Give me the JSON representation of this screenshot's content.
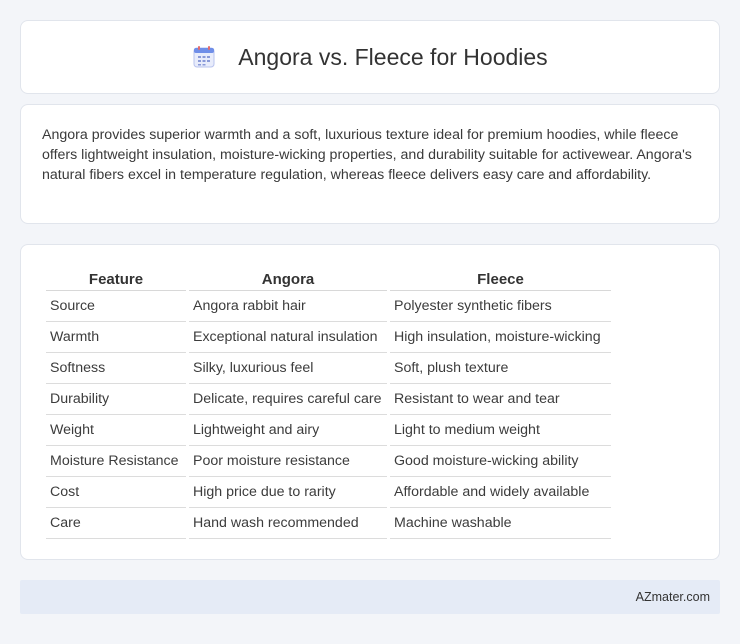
{
  "header": {
    "title": "Angora vs. Fleece for Hoodies",
    "icon": "calendar-icon"
  },
  "summary": {
    "text": "Angora provides superior warmth and a soft, luxurious texture ideal for premium hoodies, while fleece offers lightweight insulation, moisture-wicking properties, and durability suitable for activewear. Angora's natural fibers excel in temperature regulation, whereas fleece delivers easy care and affordability."
  },
  "table": {
    "headers": [
      "Feature",
      "Angora",
      "Fleece"
    ],
    "rows": [
      [
        "Source",
        "Angora rabbit hair",
        "Polyester synthetic fibers"
      ],
      [
        "Warmth",
        "Exceptional natural insulation",
        "High insulation, moisture-wicking"
      ],
      [
        "Softness",
        "Silky, luxurious feel",
        "Soft, plush texture"
      ],
      [
        "Durability",
        "Delicate, requires careful care",
        "Resistant to wear and tear"
      ],
      [
        "Weight",
        "Lightweight and airy",
        "Light to medium weight"
      ],
      [
        "Moisture Resistance",
        "Poor moisture resistance",
        "Good moisture-wicking ability"
      ],
      [
        "Cost",
        "High price due to rarity",
        "Affordable and widely available"
      ],
      [
        "Care",
        "Hand wash recommended",
        "Machine washable"
      ]
    ]
  },
  "footer": {
    "text": "AZmater.com"
  }
}
